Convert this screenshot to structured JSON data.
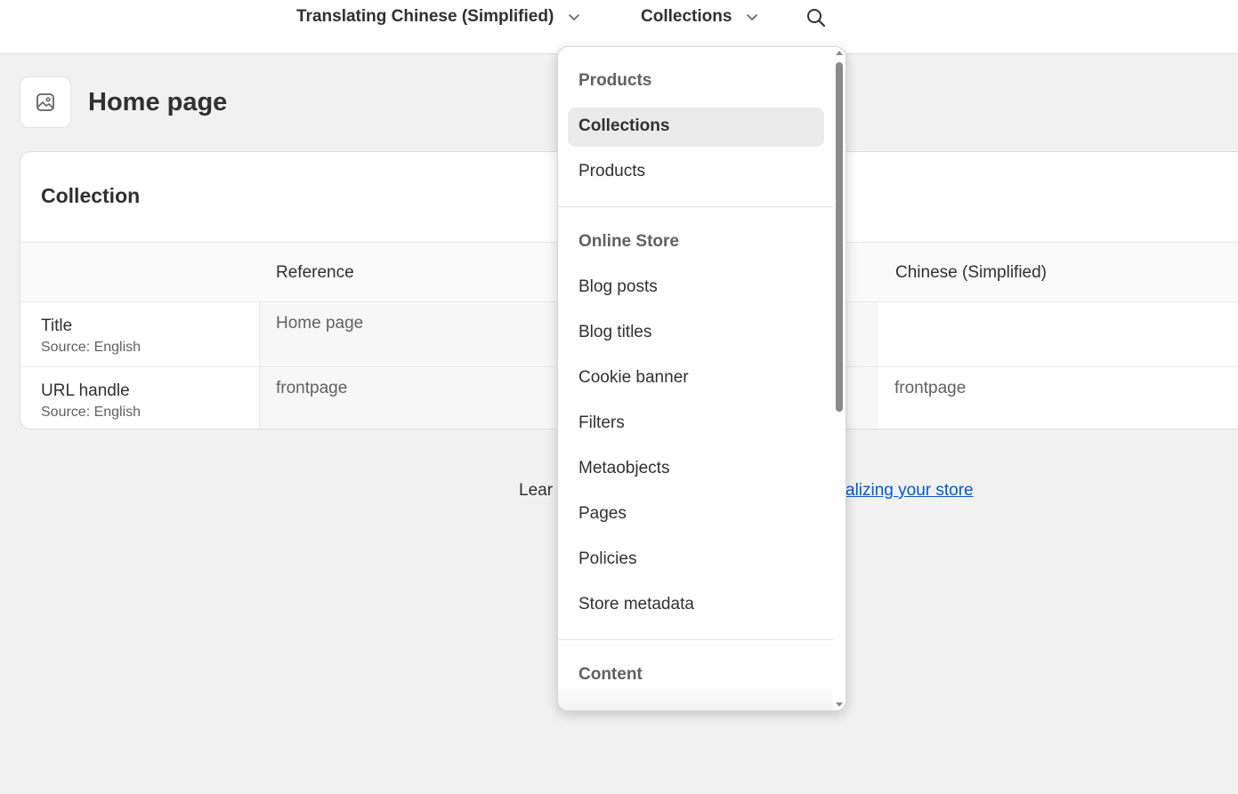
{
  "topbar": {
    "language_label": "Translating Chinese (Simplified)",
    "resource_label": "Collections"
  },
  "page": {
    "title": "Home page"
  },
  "card": {
    "title": "Collection",
    "columns": {
      "field": "",
      "reference": "Reference",
      "translation": "Chinese (Simplified)"
    },
    "rows": [
      {
        "label": "Title",
        "source": "Source: English",
        "reference": "Home page",
        "translation": ""
      },
      {
        "label": "URL handle",
        "source": "Source: English",
        "reference": "frontpage",
        "translation": "frontpage"
      }
    ]
  },
  "footer": {
    "learn_prefix": "Lear",
    "learn_link": "alizing your store"
  },
  "dropdown": {
    "sections": [
      {
        "title": "Products",
        "items": [
          "Collections",
          "Products"
        ]
      },
      {
        "title": "Online Store",
        "items": [
          "Blog posts",
          "Blog titles",
          "Cookie banner",
          "Filters",
          "Metaobjects",
          "Pages",
          "Policies",
          "Store metadata"
        ]
      },
      {
        "title": "Content",
        "items": []
      }
    ],
    "selected": "Collections"
  },
  "icons": {
    "language_chevron": "chevron-down-icon",
    "resource_chevron": "chevron-down-icon",
    "search": "search-icon",
    "page": "image-icon"
  }
}
